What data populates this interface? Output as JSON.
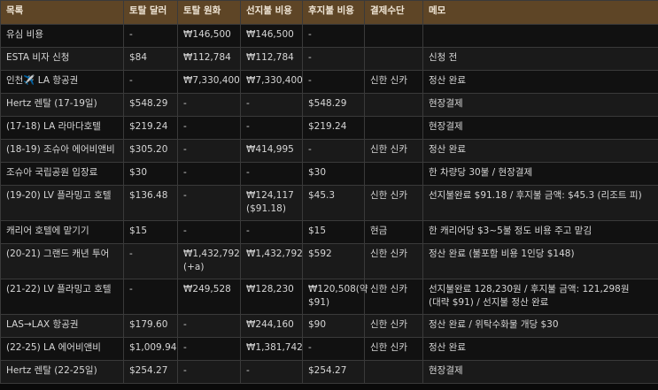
{
  "headers": [
    "목록",
    "토탈 달러",
    "토탈 원화",
    "선지불 비용",
    "후지불 비용",
    "결제수단",
    "메모"
  ],
  "rows": [
    [
      "유심 비용",
      "-",
      "₩146,500",
      "₩146,500",
      "-",
      "",
      ""
    ],
    [
      "ESTA 비자 신청",
      "$84",
      "₩112,784",
      "₩112,784",
      "-",
      "",
      "신청 전"
    ],
    [
      "인천✈️ LA 항공권",
      "-",
      "₩7,330,400",
      "₩7,330,400",
      "-",
      "신한 신카",
      "정산 완료"
    ],
    [
      "Hertz 렌탈 (17-19일)",
      "$548.29",
      "-",
      "-",
      "$548.29",
      "",
      "현장결제"
    ],
    [
      "(17-18) LA 라마다호텔",
      "$219.24",
      "-",
      "-",
      "$219.24",
      "",
      "현장결제"
    ],
    [
      "(18-19) 조슈아 에어비앤비",
      "$305.20",
      "-",
      "₩414,995",
      "-",
      "신한 신카",
      "정산 완료"
    ],
    [
      "조슈아 국립공원 입장료",
      "$30",
      "-",
      "-",
      "$30",
      "",
      "한 차량당 30불 / 현장결제"
    ],
    [
      "(19-20) LV 플라밍고 호텔",
      "$136.48",
      "-",
      "₩124,117 ($91.18)",
      "$45.3",
      "신한 신카",
      "선지불완료 $91.18 / 후지불 금액: $45.3 (리조트 피)"
    ],
    [
      "캐리어 호텔에 맡기기",
      "$15",
      "-",
      "-",
      "$15",
      "현금",
      "한 캐리어당 $3~5불 정도 비용 주고 맡김"
    ],
    [
      "(20-21) 그랜드 캐년 투어",
      "-",
      "₩1,432,792 (+a)",
      "₩1,432,792",
      "$592",
      "신한 신카",
      "정산 완료 (불포함 비용 1인당 $148)"
    ],
    [
      "(21-22) LV 플라밍고 호텔",
      "-",
      "₩249,528",
      "₩128,230",
      "₩120,508(약 $91)",
      "신한 신카",
      "선지불완료 128,230원 / 후지불 금액: 121,298원 (대략 $91) / 선지불 정산 완료"
    ],
    [
      "LAS→LAX 항공권",
      "$179.60",
      "-",
      "₩244,160",
      "$90",
      "신한 신카",
      "정산 완료 / 위탁수화물 개당 $30"
    ],
    [
      "(22-25) LA 에어비앤비",
      "$1,009.94",
      "-",
      "₩1,381,742",
      "-",
      "신한 신카",
      "정산 완료"
    ],
    [
      "Hertz 렌탈 (22-25일)",
      "$254.27",
      "-",
      "-",
      "$254.27",
      "",
      "현장결제"
    ]
  ]
}
